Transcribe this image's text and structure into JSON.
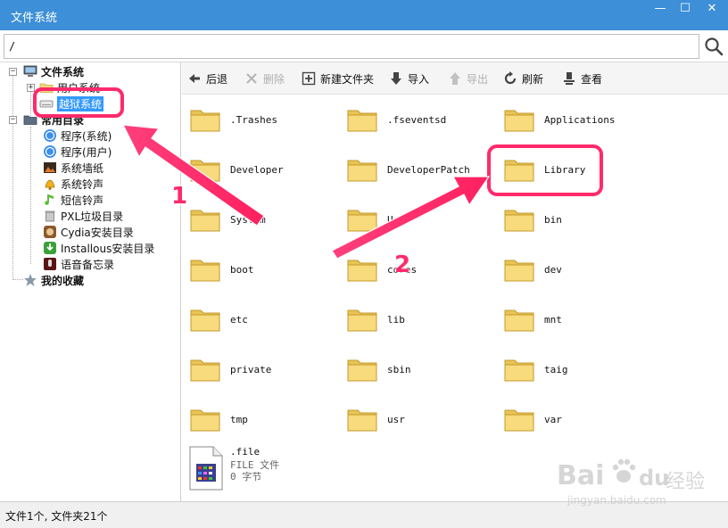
{
  "window": {
    "title": "文件系统",
    "min_glyph": "—",
    "max_glyph": "☐",
    "close_glyph": "✕"
  },
  "path_bar": {
    "value": "/",
    "search_icon": "search-icon"
  },
  "tree": {
    "root_label": "文件系统",
    "items": [
      {
        "label": "用户系统",
        "icon": "folder-icon"
      },
      {
        "label": "越狱系统",
        "icon": "drive-icon",
        "selected": true
      },
      {
        "label": "常用目录",
        "icon": "folder-icon"
      },
      {
        "label": "程序(系统)",
        "icon": "appstore-icon"
      },
      {
        "label": "程序(用户)",
        "icon": "appstore-icon"
      },
      {
        "label": "系统墙纸",
        "icon": "wallpaper-icon"
      },
      {
        "label": "系统铃声",
        "icon": "bell-icon"
      },
      {
        "label": "短信铃声",
        "icon": "music-note-icon"
      },
      {
        "label": "PXL垃圾目录",
        "icon": "trash-icon"
      },
      {
        "label": "Cydia安装目录",
        "icon": "cydia-icon"
      },
      {
        "label": "Installous安装目录",
        "icon": "installous-icon"
      },
      {
        "label": "语音备忘录",
        "icon": "voice-memo-icon"
      }
    ],
    "favorites_label": "我的收藏"
  },
  "toolbar": {
    "back": "后退",
    "delete": "删除",
    "new_folder": "新建文件夹",
    "import": "导入",
    "export": "导出",
    "refresh": "刷新",
    "view": "查看"
  },
  "files": [
    ".Trashes",
    ".fseventsd",
    "Applications",
    "Developer",
    "DeveloperPatch",
    "Library",
    "System",
    "User",
    "bin",
    "boot",
    "cores",
    "dev",
    "etc",
    "lib",
    "mnt",
    "private",
    "sbin",
    "taig",
    "tmp",
    "usr",
    "var"
  ],
  "document": {
    "name": ".file",
    "type": "FILE 文件",
    "size": "0 字节"
  },
  "status": "文件1个, 文件夹21个",
  "annotations": {
    "badge_1": "1",
    "badge_2": "2",
    "highlight_color": "#ff2a6b"
  },
  "watermark": {
    "brand": "Bai",
    "brand_du": "du",
    "jingyan": "经验",
    "url": "jingyan.baidu.com"
  },
  "colors": {
    "titlebar": "#3d8fd8",
    "folder": "#f5d77a"
  }
}
